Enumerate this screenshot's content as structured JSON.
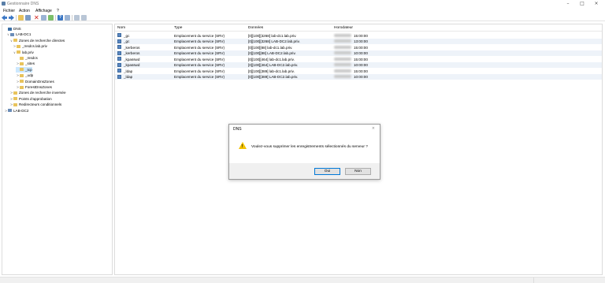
{
  "window": {
    "title": "Gestionnaire DNS"
  },
  "menu": [
    "Fichier",
    "Action",
    "Affichage",
    "?"
  ],
  "tree": [
    {
      "label": "DNS",
      "toggle": "",
      "icon": "dns"
    },
    {
      "label": "LAB-DC1",
      "toggle": "∨",
      "icon": "server"
    },
    {
      "label": "Zones de recherche directes",
      "toggle": "∨",
      "icon": "folder"
    },
    {
      "label": "_msdcs.lab.priv",
      "toggle": ">",
      "icon": "folder"
    },
    {
      "label": "lab.priv",
      "toggle": "∨",
      "icon": "folder"
    },
    {
      "label": "_msdcs",
      "toggle": "",
      "icon": "folder"
    },
    {
      "label": "_sites",
      "toggle": ">",
      "icon": "folder"
    },
    {
      "label": "_tcp",
      "toggle": "",
      "icon": "folder"
    },
    {
      "label": "_udp",
      "toggle": ">",
      "icon": "folder"
    },
    {
      "label": "DomainDnsZones",
      "toggle": ">",
      "icon": "folder"
    },
    {
      "label": "ForestDnsZones",
      "toggle": ">",
      "icon": "folder"
    },
    {
      "label": "Zones de recherche inversée",
      "toggle": ">",
      "icon": "folder"
    },
    {
      "label": "Points d'approbation",
      "toggle": ">",
      "icon": "folder"
    },
    {
      "label": "Redirecteurs conditionnels",
      "toggle": ">",
      "icon": "folder"
    },
    {
      "label": "LAB-DC2",
      "toggle": ">",
      "icon": "server"
    }
  ],
  "list": {
    "columns": [
      "Nom",
      "Type",
      "Données",
      "Horodateur"
    ],
    "rows": [
      {
        "name": "_gc",
        "type": "Emplacement du service (SRV)",
        "data": "[0][100][3268] lab-dc1.lab.priv.",
        "time": "15:00:00"
      },
      {
        "name": "_gc",
        "type": "Emplacement du service (SRV)",
        "data": "[0][100][3268] LAB-DC2.lab.priv.",
        "time": "13:00:00"
      },
      {
        "name": "_kerberos",
        "type": "Emplacement du service (SRV)",
        "data": "[0][100][88] lab-dc1.lab.priv.",
        "time": "15:00:00"
      },
      {
        "name": "_kerberos",
        "type": "Emplacement du service (SRV)",
        "data": "[0][100][88] LAB-DC2.lab.priv.",
        "time": "10:00:00"
      },
      {
        "name": "_kpasswd",
        "type": "Emplacement du service (SRV)",
        "data": "[0][100][464] lab-dc1.lab.priv.",
        "time": "15:00:00"
      },
      {
        "name": "_kpasswd",
        "type": "Emplacement du service (SRV)",
        "data": "[0][100][464] LAB-DC2.lab.priv.",
        "time": "10:00:00"
      },
      {
        "name": "_ldap",
        "type": "Emplacement du service (SRV)",
        "data": "[0][100][389] lab-dc1.lab.priv.",
        "time": "15:00:00"
      },
      {
        "name": "_ldap",
        "type": "Emplacement du service (SRV)",
        "data": "[0][100][389] LAB-DC2.lab.priv.",
        "time": "10:00:00"
      }
    ]
  },
  "dialog": {
    "title": "DNS",
    "close": "×",
    "message": "Voulez-vous supprimer les enregistrements sélectionnés du serveur ?",
    "ok_label": "Oui",
    "no_label": "Non"
  },
  "colors": {
    "accent": "#0078d7",
    "warning": "#f2c200",
    "folder": "#e8c35c",
    "selection": "#cce8ff"
  }
}
